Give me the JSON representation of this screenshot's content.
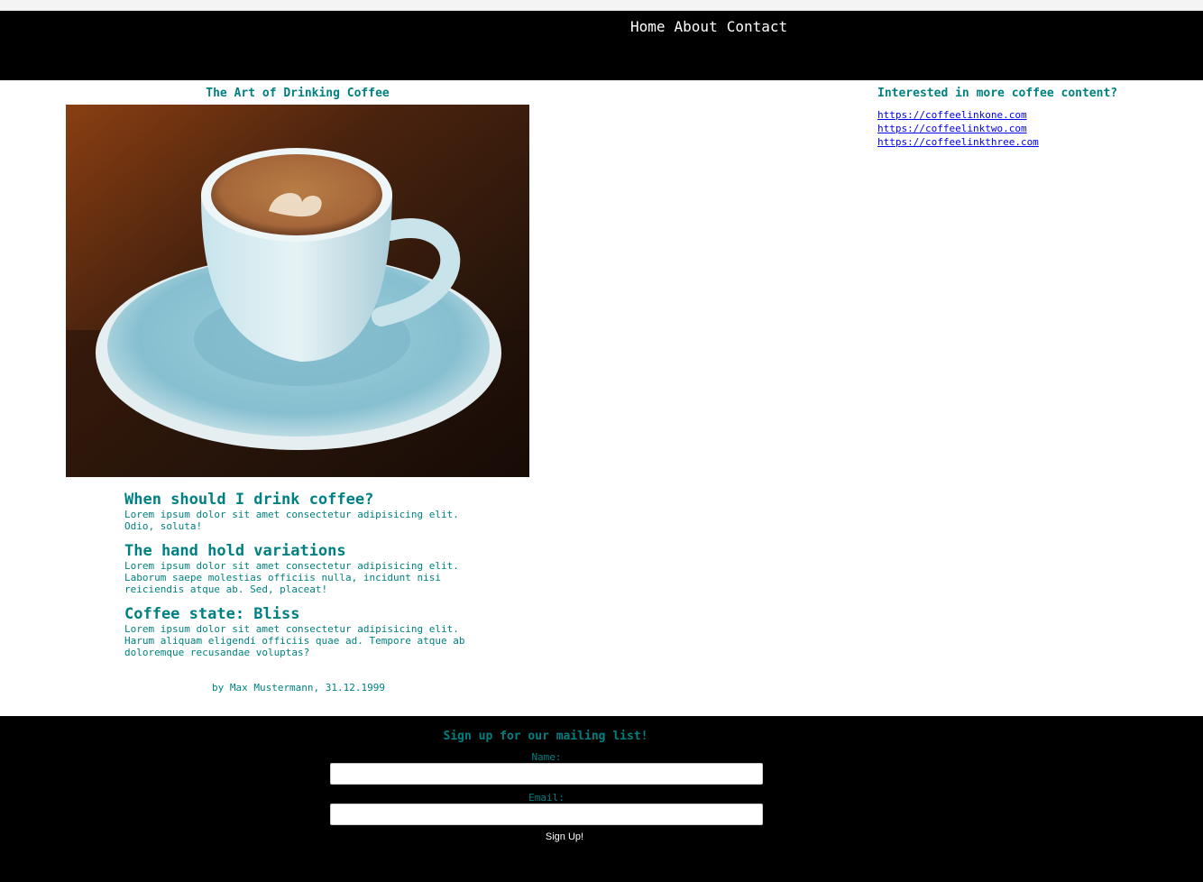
{
  "nav": {
    "items": [
      {
        "label": "Home"
      },
      {
        "label": "About"
      },
      {
        "label": "Contact"
      }
    ]
  },
  "article": {
    "title": "The Art of Drinking Coffee",
    "image_alt": "coffee-cup-on-saucer",
    "sections": [
      {
        "heading": "When should I drink coffee?",
        "body": "Lorem ipsum dolor sit amet consectetur adipisicing elit. Odio, soluta!"
      },
      {
        "heading": "The hand hold variations",
        "body": "Lorem ipsum dolor sit amet consectetur adipisicing elit. Laborum saepe molestias officiis nulla, incidunt nisi reiciendis atque ab. Sed, placeat!"
      },
      {
        "heading": "Coffee state: Bliss",
        "body": "Lorem ipsum dolor sit amet consectetur adipisicing elit. Harum aliquam eligendi officiis quae ad. Tempore atque ab doloremque recusandae voluptas?"
      }
    ],
    "byline": "by Max Mustermann, 31.12.1999"
  },
  "aside": {
    "heading": "Interested in more coffee content?",
    "links": [
      {
        "label": "https://coffeelinkone.com"
      },
      {
        "label": "https://coffeelinktwo.com"
      },
      {
        "label": "https://coffeelinkthree.com"
      }
    ]
  },
  "footer": {
    "title": "Sign up for our mailing list!",
    "name_label": "Name:",
    "name_value": "",
    "email_label": "Email:",
    "email_value": "",
    "submit_label": "Sign Up!"
  },
  "colors": {
    "accent": "#008080",
    "bar_background": "#000000",
    "link": "#0000ee"
  }
}
